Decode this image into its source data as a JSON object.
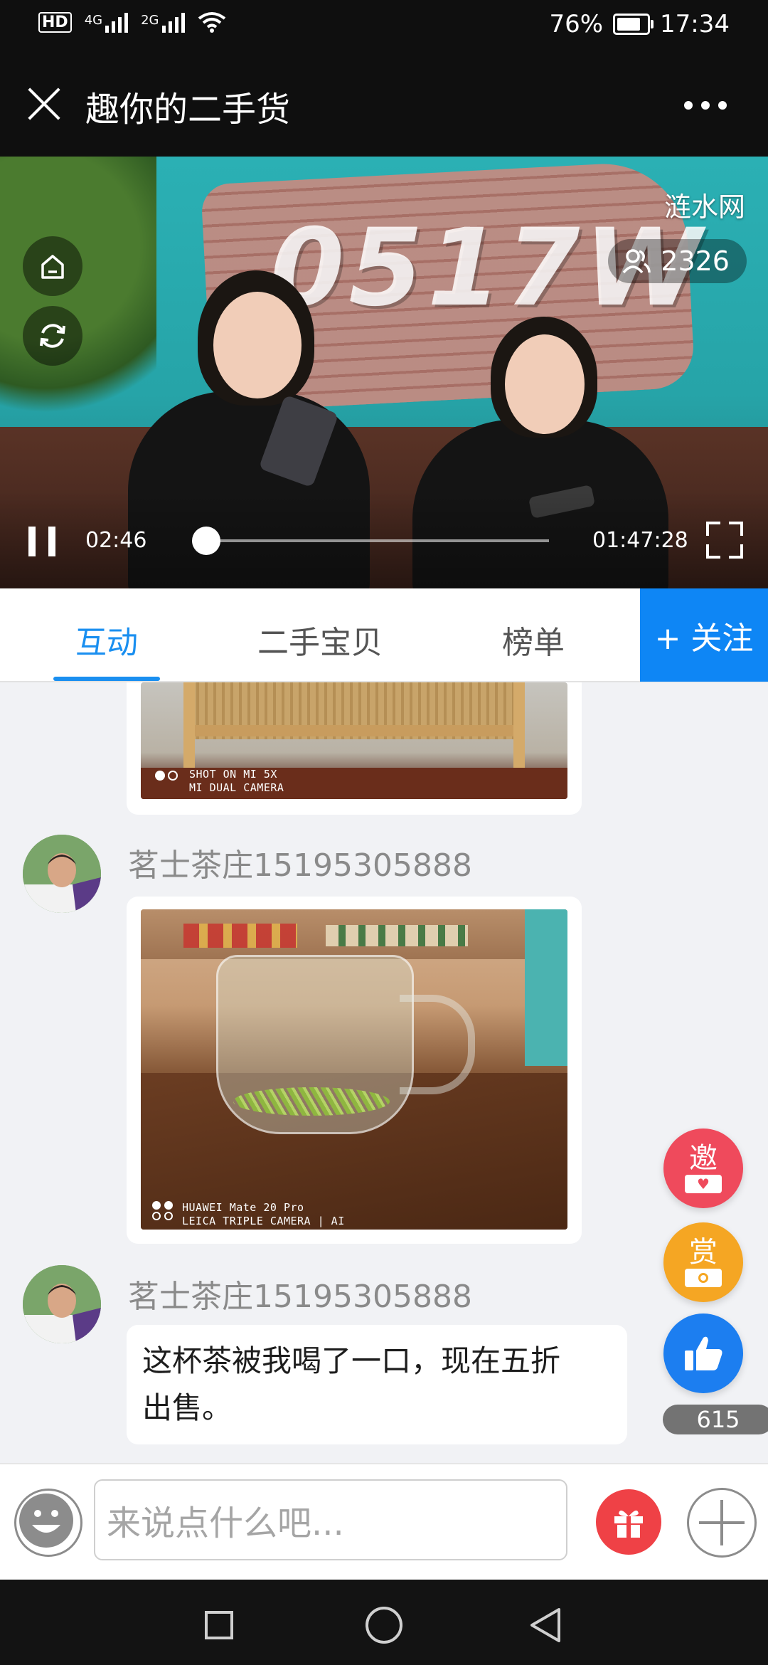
{
  "status_bar": {
    "hd_label": "HD",
    "network_1": "4G",
    "network_2": "2G",
    "battery": "76%",
    "time": "17:34"
  },
  "title_bar": {
    "title": "趣你的二手货",
    "close_icon": "close-icon",
    "more_icon": "more-dots-icon"
  },
  "video": {
    "watermark": "涟水网",
    "viewer_count": "2326",
    "logo_text": "0517W",
    "elapsed": "02:46",
    "duration": "01:47:28",
    "progress_fraction": 0.025
  },
  "tabs": {
    "items": [
      "互动",
      "二手宝贝",
      "榜单"
    ],
    "active_index": 0,
    "follow_label": "+ 关注"
  },
  "chat": {
    "messages": [
      {
        "type": "image",
        "caption_line1": "SHOT ON MI 5X",
        "caption_line2": "MI DUAL CAMERA"
      },
      {
        "type": "image",
        "username": "茗士茶庄15195305888",
        "caption_line1": "HUAWEI Mate 20 Pro",
        "caption_line2": "LEICA TRIPLE CAMERA | AI"
      },
      {
        "type": "text",
        "username": "茗士茶庄15195305888",
        "text_line1": "这杯茶被我喝了一口，现在五折",
        "text_line2": "出售。"
      }
    ]
  },
  "floating": {
    "invite_label": "邀",
    "reward_label": "赏",
    "like_count": "615"
  },
  "input_bar": {
    "placeholder": "来说点什么吧..."
  },
  "colors": {
    "accent": "#1a8ff0",
    "follow_bg": "#0e86f5",
    "invite": "#ef4a5c",
    "reward": "#f5a623",
    "like": "#1c7ef0",
    "gift": "#ef4146"
  }
}
